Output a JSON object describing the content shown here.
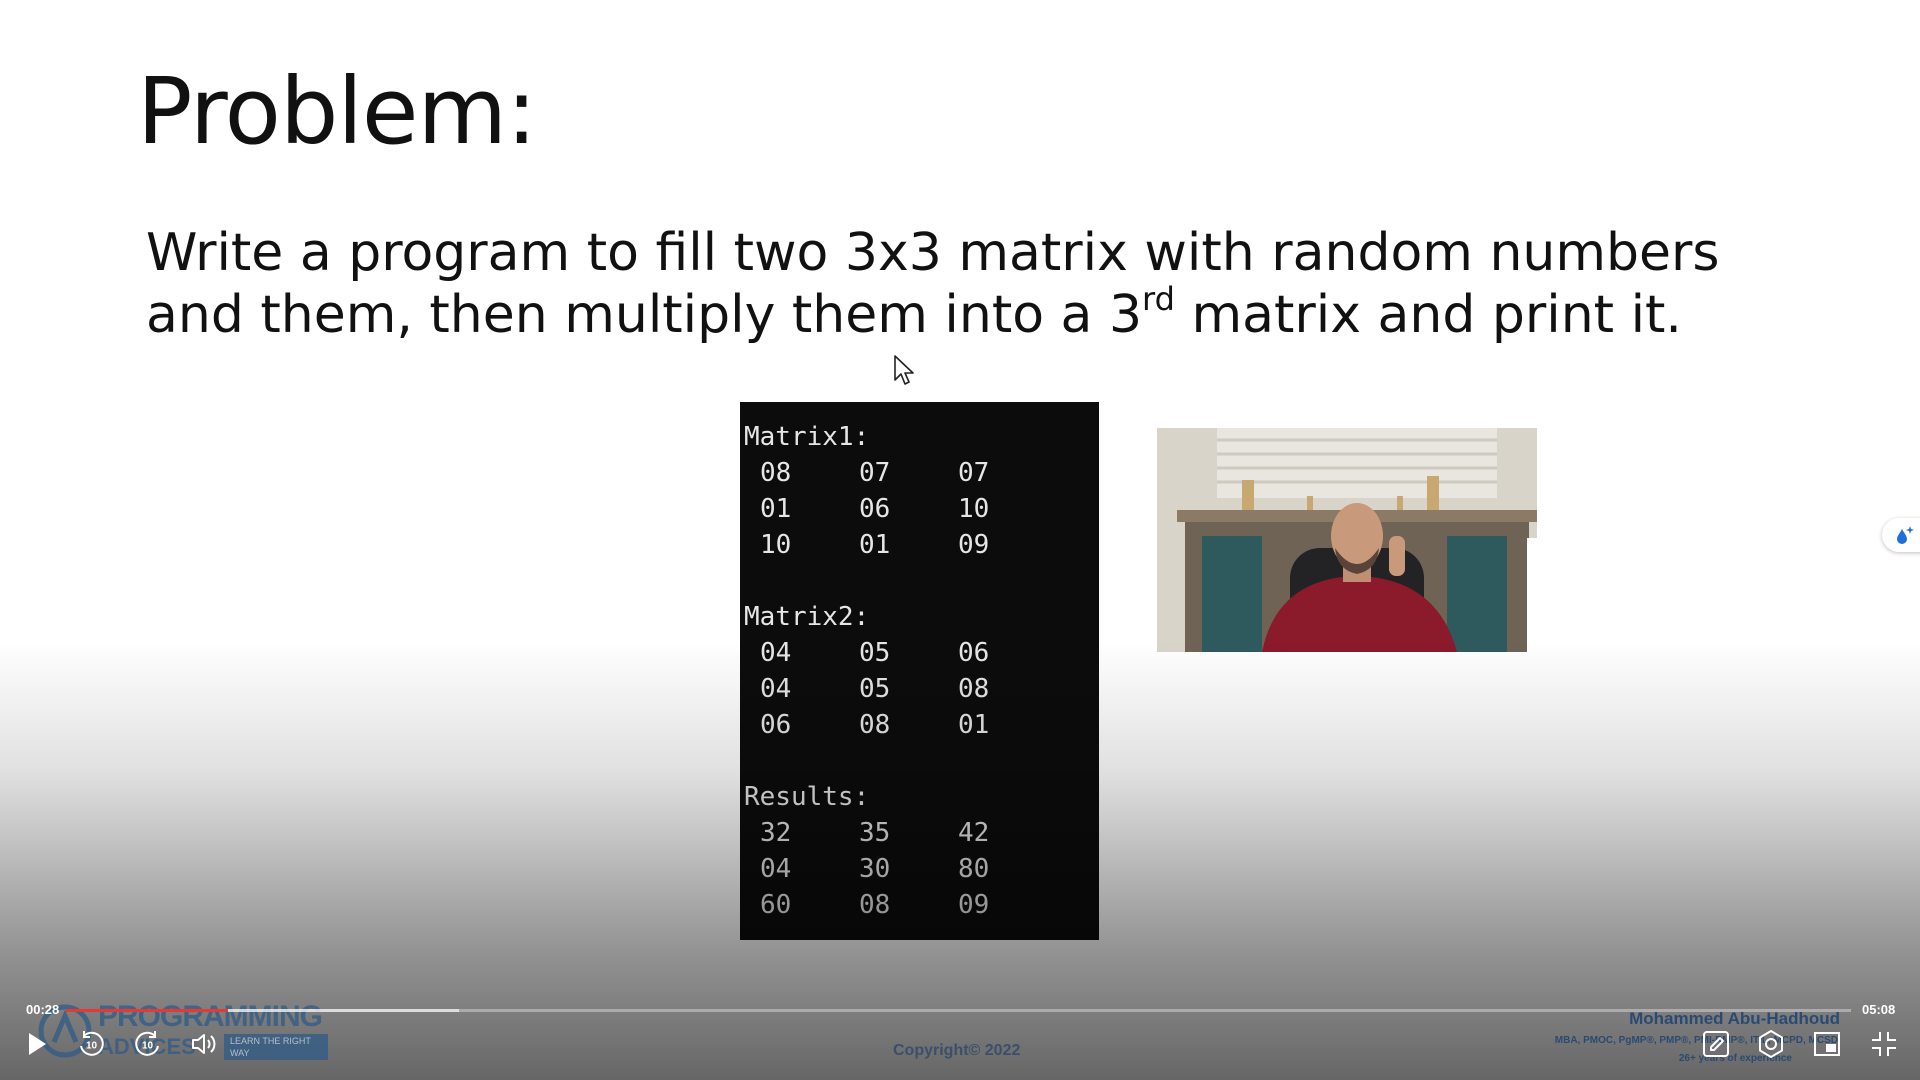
{
  "slide": {
    "title": "Problem:",
    "line1": "Write a program to fill two 3x3 matrix with random numbers",
    "line2_before": "and them, then multiply them into a 3",
    "line2_sup": "rd",
    "line2_after": " matrix and print it."
  },
  "console": {
    "matrix1_label": "Matrix1:",
    "matrix1": [
      [
        "08",
        "07",
        "07"
      ],
      [
        "01",
        "06",
        "10"
      ],
      [
        "10",
        "01",
        "09"
      ]
    ],
    "matrix2_label": "Matrix2:",
    "matrix2": [
      [
        "04",
        "05",
        "06"
      ],
      [
        "04",
        "05",
        "08"
      ],
      [
        "06",
        "08",
        "01"
      ]
    ],
    "results_label": "Results:",
    "results": [
      [
        "32",
        "35",
        "42"
      ],
      [
        "04",
        "30",
        "80"
      ],
      [
        "60",
        "08",
        "09"
      ]
    ]
  },
  "footer": {
    "logo_line1": "PROGRAMMING",
    "logo_line2": "ADVICES",
    "logo_tag": "LEARN THE RIGHT WAY",
    "copyright": "Copyright© 2022",
    "author_name": "Mohammed Abu-Hadhoud",
    "author_creds": "MBA, PMOC, PgMP®, PMP®, PMI-RMP®, ITIL, MCPD, MCSD",
    "author_experience": "26+ years of experience"
  },
  "player": {
    "current_time": "00:28",
    "total_time": "05:08",
    "progress_fraction": 0.091,
    "buffered_fraction": 0.22,
    "skip_back_label": "10",
    "skip_forward_label": "10",
    "accent_color": "#e53935"
  },
  "icons": {
    "cursor": "mouse-pointer-icon",
    "play": "play-icon",
    "rewind": "rewind-10-icon",
    "forward": "forward-10-icon",
    "volume": "volume-icon",
    "annotate": "pencil-icon",
    "settings": "gear-icon",
    "pip": "picture-in-picture-icon",
    "fullscreen_exit": "exit-fullscreen-icon",
    "side_tool": "sparkle-drop-icon"
  }
}
